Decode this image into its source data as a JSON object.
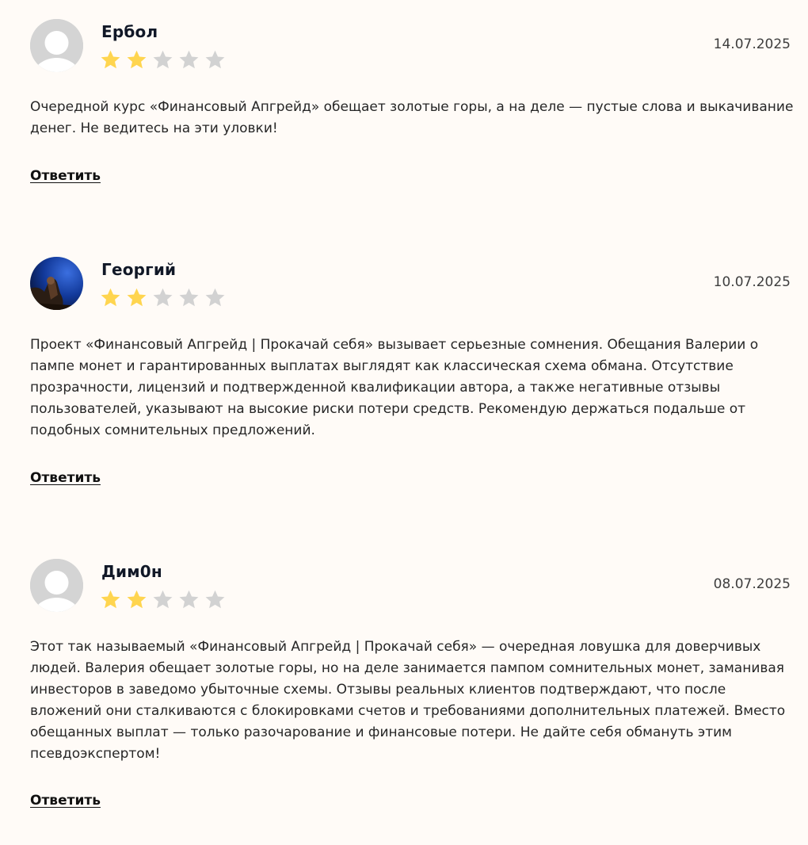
{
  "reviews": [
    {
      "author": "Ербол",
      "avatar": "default-avatar-icon",
      "date": "14.07.2025",
      "rating": 2,
      "rating_max": 5,
      "text": "Очередной курс «Финансовый Апгрейд» обещает золотые горы, а на деле — пустые слова и выкачивание денег. Не ведитесь на эти уловки!",
      "reply_label": "Ответить"
    },
    {
      "author": "Георгий",
      "avatar": "photo-avatar",
      "date": "10.07.2025",
      "rating": 2,
      "rating_max": 5,
      "text": "Проект «Финансовый Апгрейд | Прокачай себя» вызывает серьезные сомнения. Обещания Валерии о пампе монет и гарантированных выплатах выглядят как классическая схема обмана. Отсутствие прозрачности, лицензий и подтвержденной квалификации автора, а также негативные отзывы пользователей, указывают на высокие риски потери средств. Рекомендую держаться подальше от подобных сомнительных предложений.",
      "reply_label": "Ответить"
    },
    {
      "author": "Дим0н",
      "avatar": "default-avatar-icon",
      "date": "08.07.2025",
      "rating": 2,
      "rating_max": 5,
      "text": "Этот так называемый «Финансовый Апгрейд | Прокачай себя» — очередная ловушка для доверчивых людей. Валерия обещает золотые горы, но на деле занимается пампом сомнительных монет, заманивая инвесторов в заведомо убыточные схемы. Отзывы реальных клиентов подтверждают, что после вложений они сталкиваются с блокировками счетов и требованиями дополнительных платежей. Вместо обещанных выплат — только разочарование и финансовые потери. Не дайте себя обмануть этим псевдоэкспертом!",
      "reply_label": "Ответить"
    }
  ],
  "colors": {
    "background": "#fffbf7",
    "star_filled": "#ffd54f",
    "star_empty": "#d2d2d2",
    "author": "#111827",
    "text": "#262626",
    "date": "#3e3e3e"
  }
}
